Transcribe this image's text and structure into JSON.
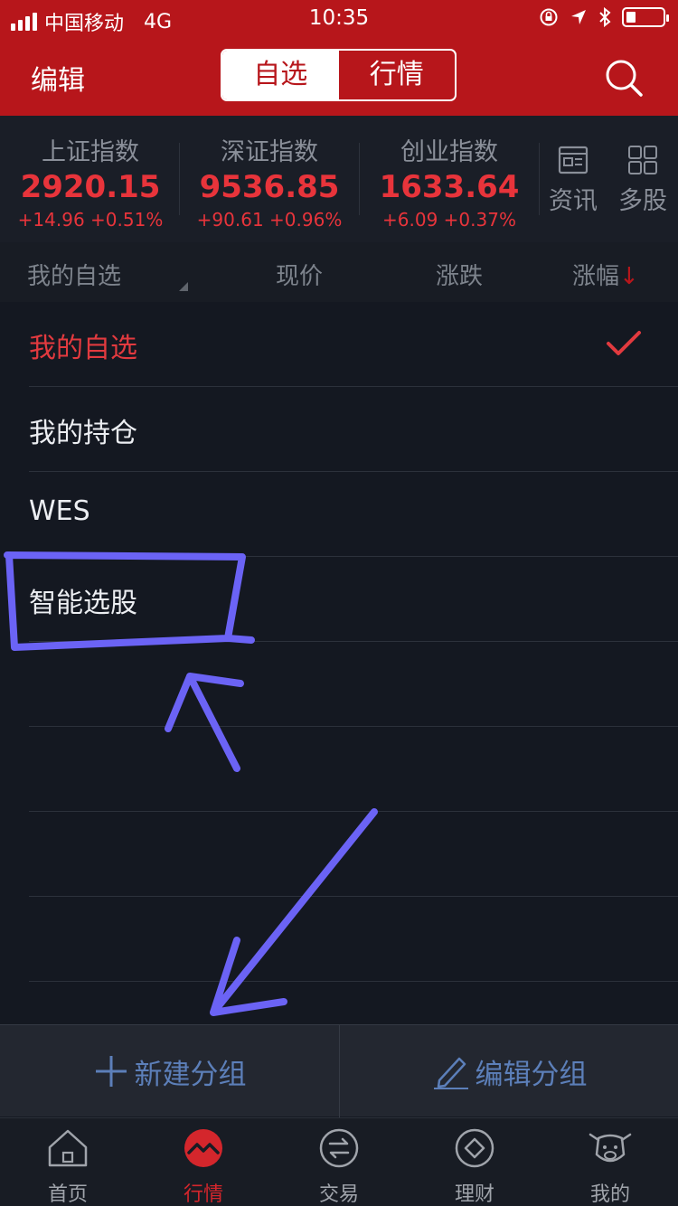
{
  "status_bar": {
    "carrier": "中国移动",
    "network": "4G",
    "time": "10:35"
  },
  "header": {
    "edit_label": "编辑",
    "tabs": [
      {
        "label": "自选",
        "selected": true
      },
      {
        "label": "行情",
        "selected": false
      }
    ],
    "search_icon": "search-icon"
  },
  "indices": [
    {
      "name": "上证指数",
      "value": "2920.15",
      "change": "+14.96 +0.51%"
    },
    {
      "name": "深证指数",
      "value": "9536.85",
      "change": "+90.61 +0.96%"
    },
    {
      "name": "创业指数",
      "value": "1633.64",
      "change": "+6.09 +0.37%"
    }
  ],
  "tools": [
    {
      "label": "资讯",
      "icon": "news-icon"
    },
    {
      "label": "多股",
      "icon": "grid-icon"
    }
  ],
  "columns": {
    "group": "我的自选",
    "price": "现价",
    "change": "涨跌",
    "change_pct": "涨幅",
    "sort_arrow": "↓"
  },
  "groups": [
    {
      "label": "我的自选",
      "selected": true
    },
    {
      "label": "我的持仓",
      "selected": false
    },
    {
      "label": "WES",
      "selected": false
    },
    {
      "label": "智能选股",
      "selected": false
    }
  ],
  "actions": {
    "new_group": "新建分组",
    "edit_group": "编辑分组"
  },
  "tabbar": [
    {
      "label": "首页",
      "icon": "home-icon",
      "selected": false
    },
    {
      "label": "行情",
      "icon": "market-icon",
      "selected": true
    },
    {
      "label": "交易",
      "icon": "trade-icon",
      "selected": false
    },
    {
      "label": "理财",
      "icon": "finance-icon",
      "selected": false
    },
    {
      "label": "我的",
      "icon": "profile-icon",
      "selected": false
    }
  ],
  "colors": {
    "brand_red": "#b7161b",
    "up_red": "#e8343b",
    "action_blue": "#5c7fb9",
    "annotation": "#6b63f5"
  }
}
